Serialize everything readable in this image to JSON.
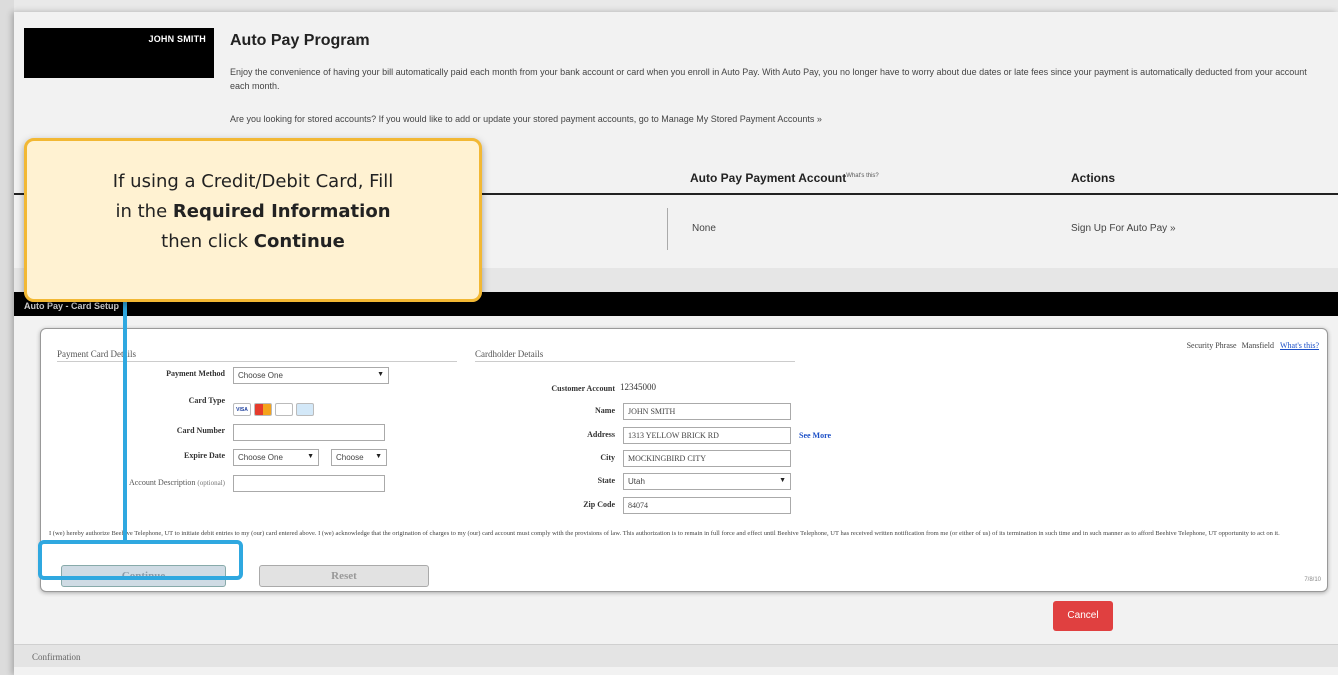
{
  "header": {
    "account_name": "JOHN SMITH",
    "program_title": "Auto Pay Program",
    "program_description": "Enjoy the convenience of having your bill automatically paid each month from your bank account or card when you enroll in Auto Pay. With Auto Pay, you no longer have to worry about due dates or late fees since your payment is automatically deducted from your account each month.",
    "stored_accounts_text": "Are you looking for stored accounts? If you would like to add or update your stored payment accounts, go to Manage My Stored Payment Accounts »"
  },
  "account_table": {
    "col_payment_account": "Auto Pay Payment Account",
    "col_payment_account_help": "What's this?",
    "col_actions": "Actions",
    "row_payment_account": "None",
    "row_action": "Sign Up For Auto Pay »"
  },
  "card_setup": {
    "section_title": "Auto Pay - Card Setup",
    "security_phrase_label": "Security Phrase",
    "security_phrase_value": "Mansfield",
    "security_phrase_help": "What's this?",
    "payment_card_details": {
      "legend": "Payment Card Details",
      "payment_method_label": "Payment Method",
      "payment_method_value": "Choose One",
      "card_type_label": "Card Type",
      "card_types": [
        "VISA",
        "MC",
        "DISC",
        "AMEX"
      ],
      "card_number_label": "Card Number",
      "card_number_value": "",
      "expire_date_label": "Expire Date",
      "expire_month_value": "Choose One",
      "expire_year_value": "Choose",
      "account_description_label": "Account Description",
      "account_description_optional": "(optional)",
      "account_description_value": ""
    },
    "cardholder_details": {
      "legend": "Cardholder Details",
      "customer_account_label": "Customer Account",
      "customer_account_value": "12345000",
      "name_label": "Name",
      "name_value": "JOHN SMITH",
      "address_label": "Address",
      "address_value": "1313 YELLOW BRICK RD",
      "see_more": "See More",
      "city_label": "City",
      "city_value": "MOCKINGBIRD CITY",
      "state_label": "State",
      "state_value": "Utah",
      "zip_label": "Zip Code",
      "zip_value": "84074"
    },
    "authorization_text": "I (we) hereby authorize Beehive Telephone, UT to initiate debit entries to my (our) card entered above. I (we) acknowledge that the origination of charges to my (our) card account must comply with the provisions of law. This authorization is to remain in full force and effect until Beehive Telephone, UT has received written notification from me (or either of us) of its termination in such time and in such manner as to afford Beehive Telephone, UT opportunity to act on it.",
    "continue_label": "Continue",
    "reset_label": "Reset",
    "page_indicator": "7/8/10"
  },
  "cancel_label": "Cancel",
  "confirmation_label": "Confirmation",
  "callout": {
    "line1": "If using a Credit/Debit Card, Fill",
    "line2_prefix": "in the ",
    "line2_bold": "Required Information",
    "line3_prefix": "then click ",
    "line3_bold": "Continue"
  },
  "colors": {
    "callout_border": "#f2b834",
    "callout_fill": "#fff2d2",
    "highlight": "#2fa8e0",
    "cancel": "#e04040",
    "link": "#1b4fc7"
  }
}
